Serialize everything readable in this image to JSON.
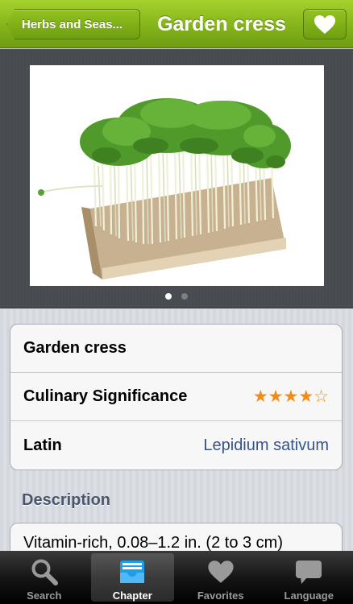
{
  "navbar": {
    "back_label": "Herbs and Seas...",
    "title": "Garden cress",
    "favorite_icon": "heart-icon"
  },
  "gallery": {
    "page_count": 2,
    "current_page": 1
  },
  "details": {
    "name": "Garden cress",
    "culinary_label": "Culinary Significance",
    "culinary_rating": 4,
    "culinary_max": 5,
    "culinary_stars": "★★★★☆",
    "latin_label": "Latin",
    "latin_value": "Lepidium sativum"
  },
  "description": {
    "header": "Description",
    "text": "Vitamin-rich, 0.08–1.2 in. (2 to 3 cm)"
  },
  "tabbar": {
    "tabs": [
      {
        "label": "Search",
        "icon": "search-icon"
      },
      {
        "label": "Chapter",
        "icon": "chapter-tray-icon",
        "selected": true
      },
      {
        "label": "Favorites",
        "icon": "heart-icon"
      },
      {
        "label": "Language",
        "icon": "speech-bubble-icon"
      }
    ]
  },
  "colors": {
    "nav_green": "#84b41a",
    "star_orange": "#f08c1a",
    "link_blue": "#385487"
  }
}
